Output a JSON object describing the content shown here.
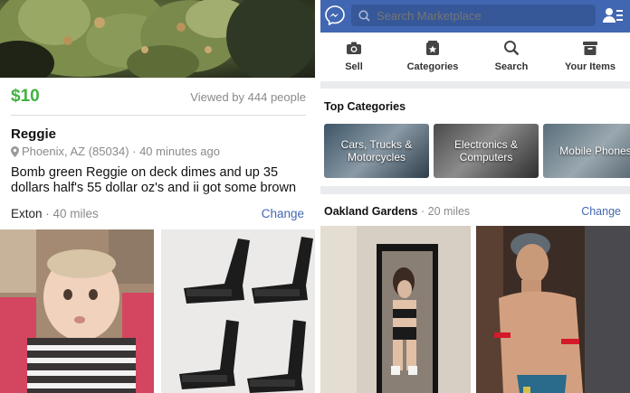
{
  "left": {
    "price": "$10",
    "views": "Viewed by 444 people",
    "title": "Reggie",
    "location": "Phoenix, AZ (85034) · 40 minutes ago",
    "description": "Bomb green Reggie on deck dimes and up 35 dollars half's 55 dollar oz's and ii got some brown",
    "nearby_location": "Exton",
    "nearby_distance": "· 40 miles",
    "change_label": "Change"
  },
  "right": {
    "search_placeholder": "Search Marketplace",
    "actions": [
      {
        "label": "Sell",
        "icon": "camera-icon"
      },
      {
        "label": "Categories",
        "icon": "categories-icon"
      },
      {
        "label": "Search",
        "icon": "search-icon"
      },
      {
        "label": "Your Items",
        "icon": "box-icon"
      }
    ],
    "section_title": "Top Categories",
    "categories": [
      "Cars, Trucks & Motorcycles",
      "Electronics & Computers",
      "Mobile Phones"
    ],
    "nearby_location": "Oakland Gardens",
    "nearby_distance": "· 20 miles",
    "change_label": "Change"
  },
  "colors": {
    "brand": "#4267b2",
    "price": "#3fb33f",
    "muted": "#8a8a8a"
  }
}
